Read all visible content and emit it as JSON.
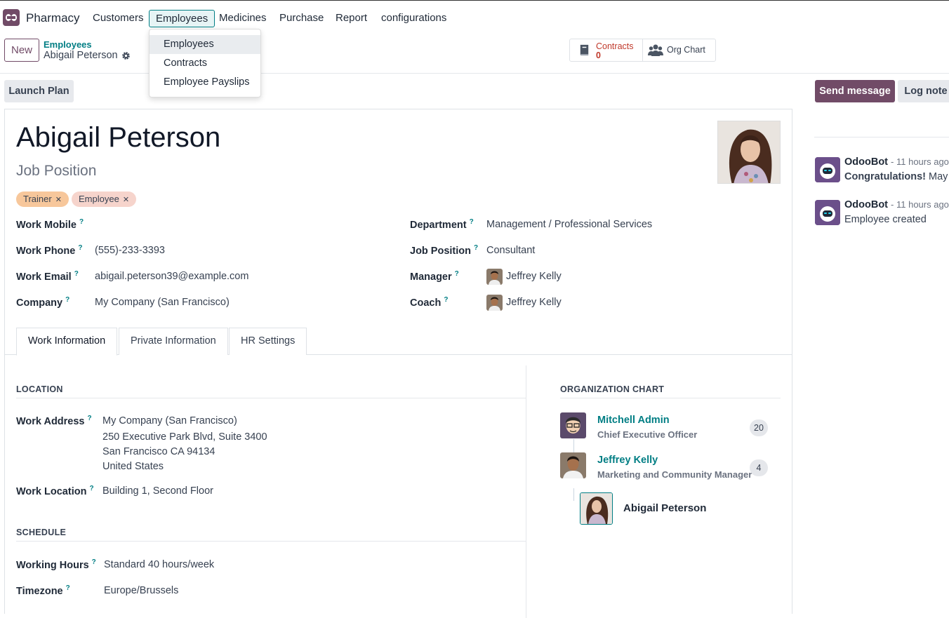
{
  "app": {
    "name": "Pharmacy"
  },
  "menu": [
    {
      "label": "Customers"
    },
    {
      "label": "Employees"
    },
    {
      "label": "Medicines"
    },
    {
      "label": "Purchase"
    },
    {
      "label": "Report"
    },
    {
      "label": "configurations"
    }
  ],
  "dropdown": [
    "Employees",
    "Contracts",
    "Employee Payslips"
  ],
  "control": {
    "new_label": "New",
    "breadcrumb_parent": "Employees",
    "breadcrumb_current": "Abigail Peterson",
    "contracts_label": "Contracts",
    "contracts_count": "0",
    "org_chart_label": "Org Chart",
    "launch_plan": "Launch Plan",
    "send_message": "Send message",
    "log_note": "Log note"
  },
  "employee": {
    "name": "Abigail Peterson",
    "job_position_placeholder": "Job Position",
    "tags": [
      {
        "label": "Trainer",
        "color": "#f7c79b"
      },
      {
        "label": "Employee",
        "color": "#f6d4cc"
      }
    ]
  },
  "fields": {
    "work_mobile": {
      "label": "Work Mobile",
      "value": ""
    },
    "work_phone": {
      "label": "Work Phone",
      "value": "(555)-233-3393"
    },
    "work_email": {
      "label": "Work Email",
      "value": "abigail.peterson39@example.com"
    },
    "company": {
      "label": "Company",
      "value": "My Company (San Francisco)"
    },
    "department": {
      "label": "Department",
      "value": "Management / Professional Services"
    },
    "job_position": {
      "label": "Job Position",
      "value": "Consultant"
    },
    "manager": {
      "label": "Manager",
      "value": "Jeffrey Kelly"
    },
    "coach": {
      "label": "Coach",
      "value": "Jeffrey Kelly"
    }
  },
  "tabs": [
    "Work Information",
    "Private Information",
    "HR Settings"
  ],
  "location": {
    "title": "LOCATION",
    "work_address_label": "Work Address",
    "address_lines": [
      "My Company (San Francisco)",
      "250 Executive Park Blvd, Suite 3400",
      "San Francisco CA 94134",
      "United States"
    ],
    "work_location_label": "Work Location",
    "work_location": "Building 1, Second Floor"
  },
  "schedule": {
    "title": "SCHEDULE",
    "working_hours_label": "Working Hours",
    "working_hours": "Standard 40 hours/week",
    "timezone_label": "Timezone",
    "timezone": "Europe/Brussels"
  },
  "org_chart": {
    "title": "ORGANIZATION CHART",
    "people": [
      {
        "name": "Mitchell Admin",
        "title": "Chief Executive Officer",
        "count": "20"
      },
      {
        "name": "Jeffrey Kelly",
        "title": "Marketing and Community Manager",
        "count": "4"
      }
    ],
    "self": "Abigail Peterson"
  },
  "chatter": [
    {
      "author": "OdooBot",
      "time": "- 11 hours ago",
      "body_bold": "Congratulations!",
      "body": " May I"
    },
    {
      "author": "OdooBot",
      "time": "- 11 hours ago",
      "body_bold": "",
      "body": "Employee created"
    }
  ],
  "colors": {
    "brand": "#714B67",
    "accent": "#017e84"
  }
}
